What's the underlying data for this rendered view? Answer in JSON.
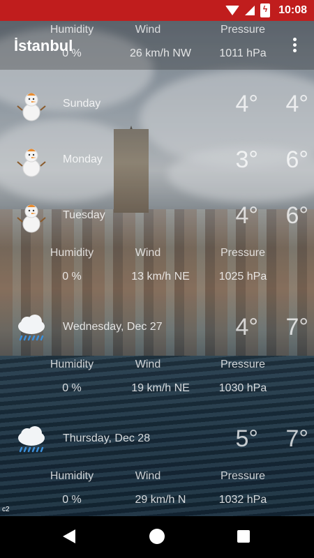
{
  "status": {
    "time": "10:08"
  },
  "header": {
    "city": "İstanbul"
  },
  "top_stats": {
    "humidity_label": "Humidity",
    "wind_label": "Wind",
    "pressure_label": "Pressure",
    "humidity": "0 %",
    "wind": "26 km/h NW",
    "pressure": "1011 hPa"
  },
  "days": [
    {
      "name": "Sunday",
      "min": "4°",
      "max": "4°",
      "icon": "snowman-icon"
    },
    {
      "name": "Monday",
      "min": "3°",
      "max": "6°",
      "icon": "snowman-icon"
    },
    {
      "name": "Tuesday",
      "min": "4°",
      "max": "6°",
      "icon": "snowman-icon",
      "stats": {
        "humidity_label": "Humidity",
        "wind_label": "Wind",
        "pressure_label": "Pressure",
        "humidity": "0 %",
        "wind": "13 km/h NE",
        "pressure": "1025 hPa"
      }
    },
    {
      "name": "Wednesday, Dec 27",
      "min": "4°",
      "max": "7°",
      "icon": "rain-cloud-icon",
      "stats": {
        "humidity_label": "Humidity",
        "wind_label": "Wind",
        "pressure_label": "Pressure",
        "humidity": "0 %",
        "wind": "19 km/h NE",
        "pressure": "1030 hPa"
      }
    },
    {
      "name": "Thursday, Dec 28",
      "min": "5°",
      "max": "7°",
      "icon": "rain-cloud-icon",
      "stats": {
        "humidity_label": "Humidity",
        "wind_label": "Wind",
        "pressure_label": "Pressure",
        "humidity": "0 %",
        "wind": "29 km/h N",
        "pressure": "1032 hPa"
      }
    }
  ],
  "footer_tag": "c2"
}
